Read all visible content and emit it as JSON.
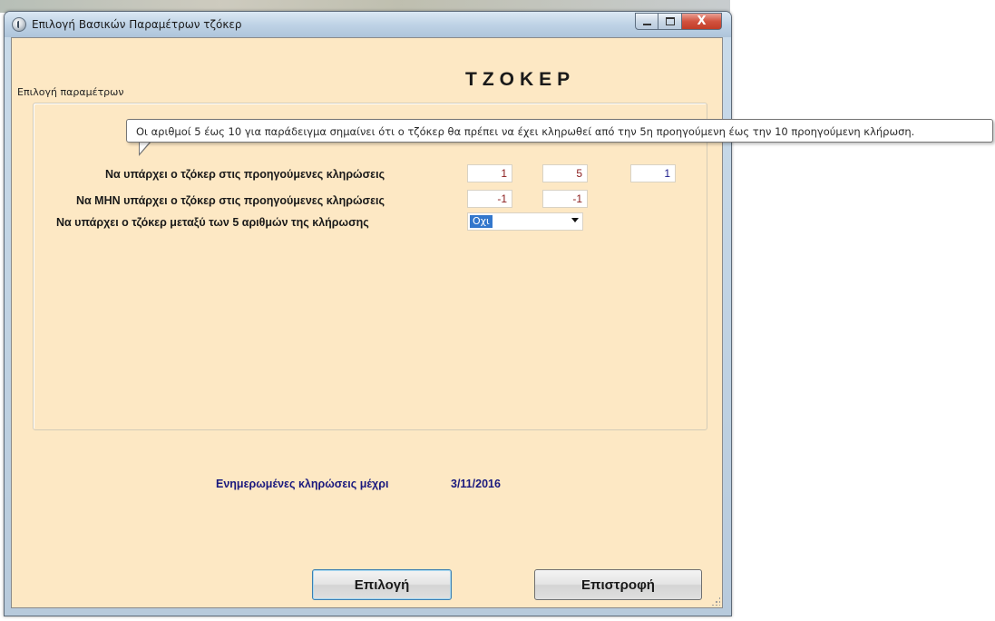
{
  "window": {
    "title": "Επιλογή Βασικών Παραμέτρων τζόκερ",
    "close_glyph": "X"
  },
  "heading": "ΤΖΟΚΕΡ",
  "group": {
    "label": "Επιλογή παραμέτρων"
  },
  "rows": {
    "exists_label": "Να υπάρχει ο τζόκερ στις προηγούμενες κληρώσεις",
    "exists_from": "1",
    "exists_to": "5",
    "exists_count": "1",
    "not_exists_label": "Να ΜΗΝ υπάρχει ο τζόκερ στις προηγούμενες κληρώσεις",
    "not_exists_from": "-1",
    "not_exists_to": "-1",
    "between_label": "Να  υπάρχει ο τζόκερ μεταξύ των 5 αριθμών της κλήρωσης",
    "between_value": "Οχι"
  },
  "tooltip": "Οι αριθμοί 5 έως 10 για παράδειγμα σημαίνει ότι ο τζόκερ θα πρέπει να έχει κληρωθεί από την 5η προηγούμενη έως την 10 προηγούμενη κλήρωση.",
  "info": {
    "label": "Ενημερωμένες κληρώσεις μέχρι",
    "date": "3/11/2016"
  },
  "buttons": {
    "select": "Επιλογή",
    "back": "Επιστροφή"
  },
  "colors": {
    "client_bg": "#fde8c4",
    "info_text": "#1a1a7e",
    "close_button": "#c13c27"
  },
  "icons": [
    "app-icon",
    "minimize-icon",
    "maximize-icon",
    "close-icon",
    "dropdown-arrow-icon",
    "resize-grip-icon"
  ]
}
